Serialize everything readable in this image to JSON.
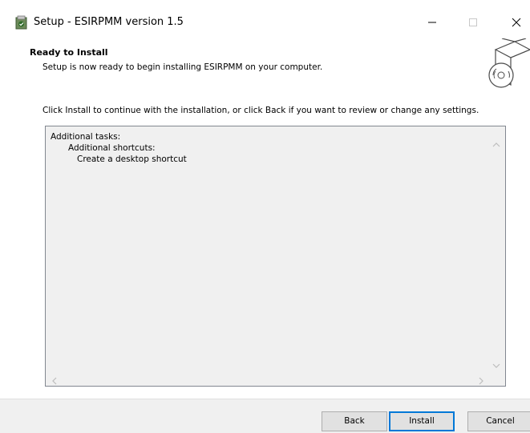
{
  "window": {
    "title": "Setup - ESIRPMM version 1.5"
  },
  "header": {
    "title": "Ready to Install",
    "subtitle": "Setup is now ready to begin installing ESIRPMM on your computer."
  },
  "body": {
    "instruction": "Click Install to continue with the installation, or click Back if you want to review or change any settings.",
    "memo_lines": [
      "Additional tasks:",
      "Additional shortcuts:",
      "Create a desktop shortcut"
    ]
  },
  "footer": {
    "back_label": "Back",
    "install_label": "Install",
    "cancel_label": "Cancel"
  },
  "colors": {
    "accent": "#0078d7",
    "footer_bg": "#f0f0f0",
    "memo_bg": "#f0f0f0"
  }
}
